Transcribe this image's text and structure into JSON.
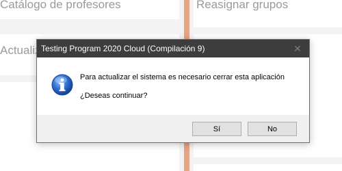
{
  "background": {
    "tiles": {
      "catalog": "Catálogo de profesores",
      "reassign": "Reasignar grupos",
      "update": "Actualiz"
    }
  },
  "dialog": {
    "title": "Testing Program 2020 Cloud (Compilación 9)",
    "icon": "info-icon",
    "message_line1": "Para actualizar el sistema es necesario cerrar esta aplicación",
    "message_line2": "¿Deseas continuar?",
    "yes_label": "Sí",
    "no_label": "No",
    "close_glyph": "✕"
  },
  "colors": {
    "accent_divider": "#e8a384",
    "titlebar": "#3d3d3d",
    "info_blue": "#2f6fd0"
  }
}
